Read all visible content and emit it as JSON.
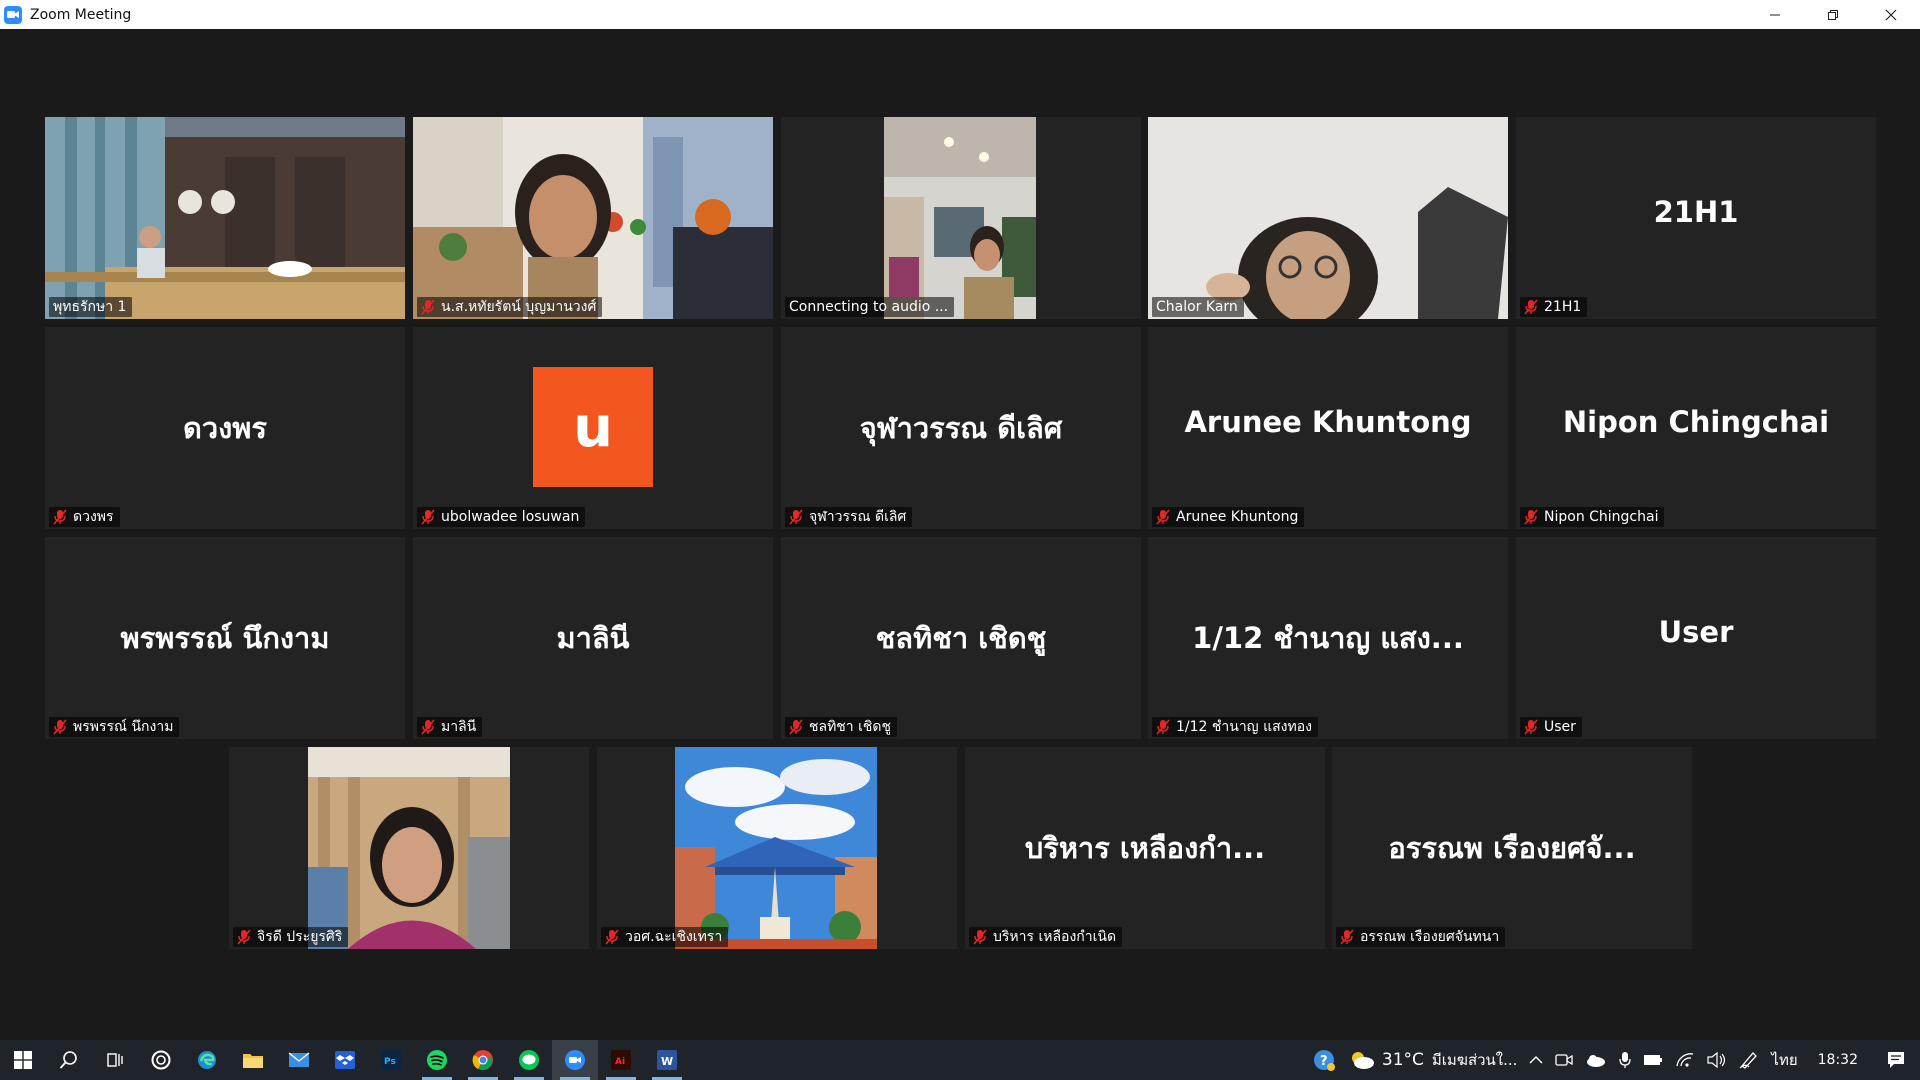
{
  "window": {
    "title": "Zoom Meeting"
  },
  "tiles": [
    {
      "label": "พุทธรักษา 1",
      "muted": false,
      "big": ""
    },
    {
      "label": "น.ส.หทัยรัตน์ บุญมานวงศ์",
      "muted": true,
      "big": ""
    },
    {
      "label": "Connecting to audio ...",
      "muted": false,
      "big": ""
    },
    {
      "label": "Chalor Karn",
      "muted": false,
      "big": ""
    },
    {
      "label": "21H1",
      "muted": true,
      "big": "21H1"
    },
    {
      "label": "ดวงพร",
      "muted": true,
      "big": "ดวงพร"
    },
    {
      "label": "ubolwadee losuwan",
      "muted": true,
      "big": "u"
    },
    {
      "label": "จุฬาวรรณ ดีเลิศ",
      "muted": true,
      "big": "จุฬาวรรณ ดีเลิศ"
    },
    {
      "label": "Arunee Khuntong",
      "muted": true,
      "big": "Arunee Khuntong"
    },
    {
      "label": "Nipon Chingchai",
      "muted": true,
      "big": "Nipon Chingchai"
    },
    {
      "label": "พรพรรณ์ นึกงาม",
      "muted": true,
      "big": "พรพรรณ์ นึกงาม"
    },
    {
      "label": "มาลินี",
      "muted": true,
      "big": "มาลินี"
    },
    {
      "label": "ชลทิชา เชิดชู",
      "muted": true,
      "big": "ชลทิชา เชิดชู"
    },
    {
      "label": "1/12 ชำนาญ แสงทอง",
      "muted": true,
      "big": "1/12 ชำนาญ แสง..."
    },
    {
      "label": "User",
      "muted": true,
      "big": "User"
    },
    {
      "label": "จิรดี ประยูรศิริ",
      "muted": true,
      "big": ""
    },
    {
      "label": "วอศ.ฉะเชิงเทรา",
      "muted": true,
      "big": ""
    },
    {
      "label": "บริหาร  เหลืองกำเนิด",
      "muted": true,
      "big": "บริหาร  เหลืองกำ..."
    },
    {
      "label": "อรรณพ เรืองยศจันทนา",
      "muted": true,
      "big": "อรรณพ เรืองยศจั..."
    }
  ],
  "taskbar": {
    "apps": [
      "windows-start",
      "search",
      "task-view",
      "cortana",
      "edge",
      "file-explorer",
      "mail",
      "dropbox",
      "photoshop",
      "spotify",
      "chrome",
      "line",
      "zoom",
      "illustrator",
      "word"
    ],
    "weather_temp": "31°C",
    "weather_text": "มีเมฆส่วนใ...",
    "language": "ไทย",
    "clock": "18:32"
  },
  "colors": {
    "active_speaker": "#c8e64a",
    "avatar_bg": "#f2571f",
    "tile_bg": "#232323",
    "mute": "#e02828"
  }
}
